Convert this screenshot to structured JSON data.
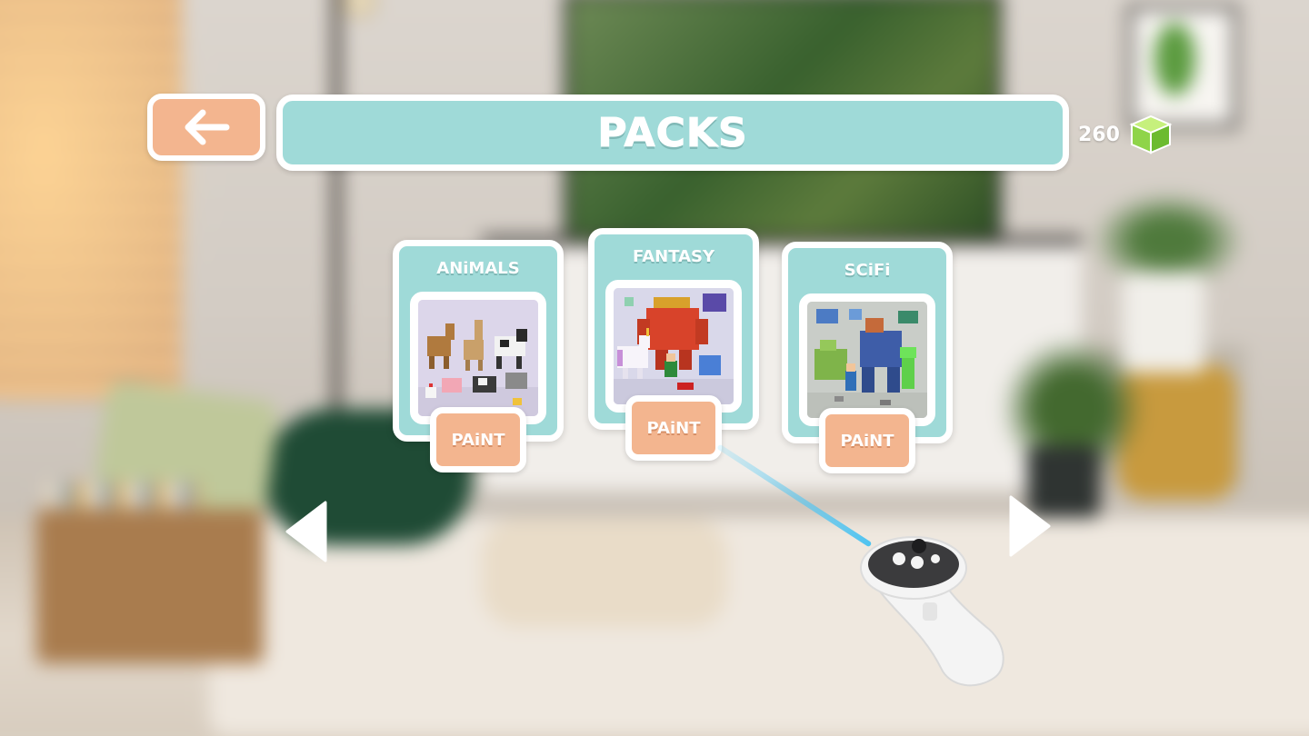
{
  "header": {
    "back_label": "",
    "title": "PACKS"
  },
  "currency": {
    "value": "260",
    "icon": "green-cube-icon"
  },
  "packs": [
    {
      "title": "ANiMALS",
      "button_label": "PAiNT",
      "art": "voxel-animals-art"
    },
    {
      "title": "FANTASY",
      "button_label": "PAiNT",
      "art": "voxel-fantasy-art"
    },
    {
      "title": "SCiFi",
      "button_label": "PAiNT",
      "art": "voxel-scifi-art"
    }
  ],
  "navigation": {
    "prev_icon": "left-triangle-icon",
    "next_icon": "right-triangle-icon"
  },
  "colors": {
    "teal": "#9fdad8",
    "peach": "#f3b58f",
    "white": "#ffffff",
    "cube_green": "#8fd449"
  }
}
